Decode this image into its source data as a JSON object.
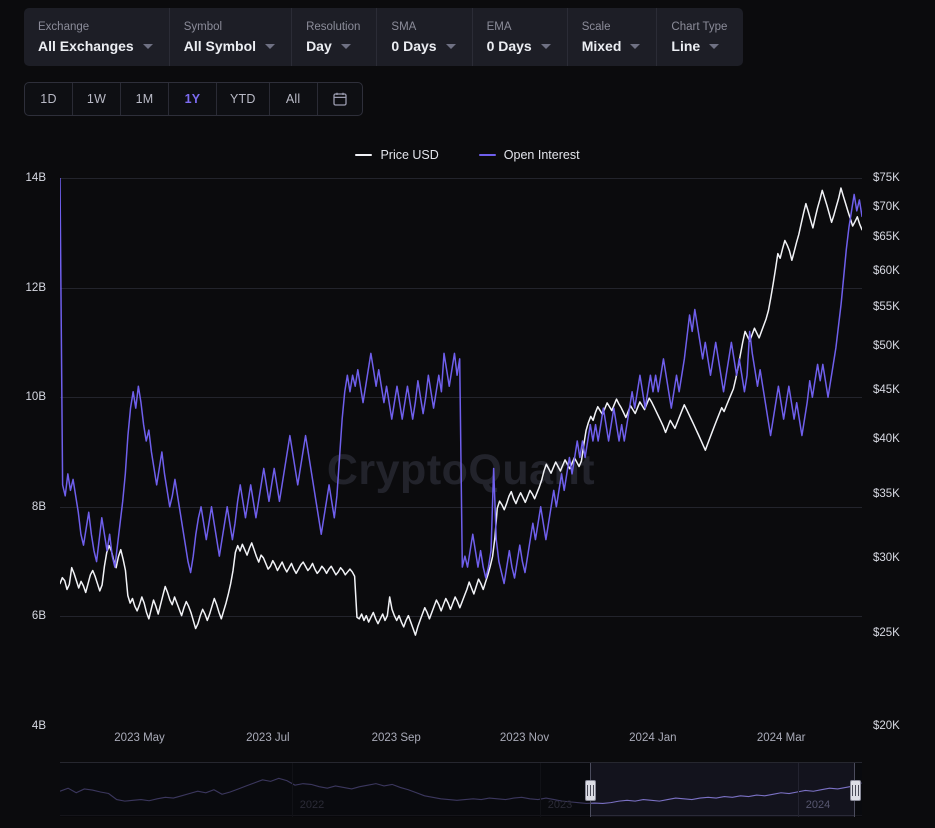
{
  "toolbar": {
    "fields": [
      {
        "label": "Exchange",
        "value": "All Exchanges"
      },
      {
        "label": "Symbol",
        "value": "All Symbol"
      },
      {
        "label": "Resolution",
        "value": "Day"
      },
      {
        "label": "SMA",
        "value": "0 Days"
      },
      {
        "label": "EMA",
        "value": "0 Days"
      },
      {
        "label": "Scale",
        "value": "Mixed"
      },
      {
        "label": "Chart Type",
        "value": "Line"
      }
    ]
  },
  "range_selector": {
    "options": [
      "1D",
      "1W",
      "1M",
      "1Y",
      "YTD",
      "All"
    ],
    "active": "1Y",
    "calendar_icon": "calendar-icon"
  },
  "watermark": "CryptoQuant",
  "colors": {
    "price": "#f2f3f7",
    "open_interest": "#6f5fec",
    "accent": "#7c6bf0",
    "background": "#0b0b0d",
    "grid": "#23242c"
  },
  "navigator": {
    "years": [
      "2022",
      "2023",
      "2024"
    ],
    "handle_left_label": "range-start-handle",
    "handle_right_label": "range-end-handle"
  },
  "chart_data": {
    "type": "line",
    "title": "",
    "xlabel": "",
    "grid": true,
    "legend_position": "top-center",
    "x_tick_labels": [
      "2023 May",
      "2023 Jul",
      "2023 Sep",
      "2023 Nov",
      "2024 Jan",
      "2024 Mar"
    ],
    "x_range": [
      "2023-03-20",
      "2024-03-20"
    ],
    "axes": [
      {
        "id": "left",
        "name": "Open Interest",
        "side": "left",
        "unit": "USD",
        "ylim": [
          4000000000,
          14000000000
        ],
        "tick_labels": [
          "4B",
          "6B",
          "8B",
          "10B",
          "12B",
          "14B"
        ],
        "tick_values": [
          4000000000,
          6000000000,
          8000000000,
          10000000000,
          12000000000,
          14000000000
        ],
        "scale": "linear"
      },
      {
        "id": "right",
        "name": "Price USD",
        "side": "right",
        "unit": "USD",
        "ylim": [
          20000,
          75000
        ],
        "tick_labels": [
          "$20K",
          "$25K",
          "$30K",
          "$35K",
          "$40K",
          "$45K",
          "$50K",
          "$55K",
          "$60K",
          "$65K",
          "$70K",
          "$75K"
        ],
        "tick_values": [
          20000,
          25000,
          30000,
          35000,
          40000,
          45000,
          50000,
          55000,
          60000,
          65000,
          70000,
          75000
        ],
        "scale": "log"
      }
    ],
    "series": [
      {
        "name": "Price USD",
        "color": "#f2f3f7",
        "axis": "right",
        "unit": "USD",
        "values": [
          28200,
          28600,
          28400,
          27800,
          28150,
          29300,
          28900,
          28400,
          27900,
          28350,
          28050,
          27600,
          28200,
          28800,
          29100,
          28700,
          28200,
          27700,
          28100,
          29400,
          30400,
          30900,
          30500,
          29800,
          29300,
          30100,
          30600,
          29900,
          29100,
          27400,
          26900,
          27200,
          26700,
          26400,
          26800,
          27300,
          26900,
          26300,
          25900,
          26500,
          27100,
          26700,
          26200,
          26800,
          27400,
          28000,
          27600,
          27100,
          26800,
          27300,
          26900,
          26500,
          26100,
          26600,
          27000,
          26700,
          26300,
          25800,
          25300,
          25600,
          26100,
          26500,
          26200,
          25800,
          26200,
          26700,
          27200,
          26800,
          26300,
          25900,
          26400,
          26900,
          27500,
          28200,
          29100,
          30400,
          30900,
          30500,
          31000,
          30600,
          30200,
          30700,
          31100,
          30600,
          30100,
          29700,
          30200,
          30000,
          29600,
          29200,
          29400,
          29800,
          29500,
          29100,
          29400,
          29700,
          29300,
          29000,
          29300,
          29600,
          29200,
          28900,
          29200,
          29500,
          29700,
          29400,
          29100,
          29300,
          29600,
          29200,
          28900,
          29100,
          29400,
          29200,
          28900,
          29200,
          29400,
          29100,
          28800,
          29000,
          29300,
          29100,
          28800,
          29000,
          29200,
          29000,
          28700,
          26000,
          25900,
          26200,
          25800,
          26100,
          25700,
          26000,
          26300,
          25900,
          25600,
          25900,
          26200,
          25800,
          26100,
          27300,
          26500,
          26100,
          25800,
          26100,
          25700,
          25400,
          25800,
          26100,
          25700,
          25300,
          24900,
          25400,
          25800,
          26200,
          26600,
          26300,
          25900,
          26300,
          26700,
          27100,
          26800,
          26400,
          26800,
          27200,
          26900,
          26500,
          26900,
          27300,
          27000,
          26600,
          27000,
          27400,
          27800,
          28300,
          27900,
          27500,
          28000,
          28500,
          28200,
          27800,
          28300,
          28800,
          29400,
          30100,
          31500,
          33800,
          34400,
          34100,
          33700,
          34200,
          34800,
          35200,
          34600,
          34200,
          34700,
          35100,
          34700,
          34300,
          34800,
          35300,
          35000,
          34600,
          35100,
          35600,
          36200,
          37000,
          37600,
          37200,
          36800,
          37300,
          37800,
          37400,
          37000,
          37500,
          38000,
          37600,
          37200,
          37700,
          38200,
          37800,
          37400,
          37900,
          39400,
          40800,
          41600,
          42200,
          41800,
          42600,
          43200,
          42800,
          42400,
          43000,
          43600,
          43200,
          42800,
          43400,
          44000,
          43500,
          43100,
          42600,
          42100,
          42700,
          43300,
          42900,
          42500,
          43100,
          43700,
          43300,
          42900,
          43500,
          44100,
          43700,
          43200,
          42700,
          42200,
          41700,
          41200,
          40600,
          41200,
          41800,
          41400,
          41000,
          41600,
          42200,
          42800,
          43400,
          42900,
          42400,
          41900,
          41400,
          40900,
          40400,
          39900,
          39400,
          38900,
          39500,
          40100,
          40700,
          41300,
          41900,
          42500,
          43100,
          42700,
          43300,
          43900,
          44500,
          45100,
          46200,
          47500,
          49000,
          50500,
          51800,
          51200,
          50600,
          51400,
          52200,
          51600,
          51000,
          51800,
          52600,
          53400,
          54500,
          56200,
          58100,
          60200,
          62500,
          61800,
          63200,
          64500,
          63800,
          62900,
          61500,
          62800,
          64200,
          65500,
          67200,
          68900,
          70500,
          69200,
          67800,
          66500,
          68200,
          69800,
          71200,
          72800,
          71500,
          70200,
          68800,
          67400,
          68600,
          70000,
          71400,
          73200,
          71800,
          70500,
          69200,
          68000,
          66800,
          67500,
          68300,
          67100,
          66200
        ]
      },
      {
        "name": "Open Interest",
        "color": "#6f5fec",
        "axis": "left",
        "unit": "USD",
        "values": [
          14000000000,
          8400000000,
          8200000000,
          8600000000,
          8300000000,
          8500000000,
          8200000000,
          7900000000,
          7500000000,
          7300000000,
          7600000000,
          7900000000,
          7500000000,
          7200000000,
          7000000000,
          7400000000,
          7800000000,
          7500000000,
          7200000000,
          7500000000,
          7100000000,
          6900000000,
          7300000000,
          7700000000,
          8100000000,
          8600000000,
          9300000000,
          9800000000,
          10100000000,
          9800000000,
          10200000000,
          9900000000,
          9500000000,
          9200000000,
          9400000000,
          9000000000,
          8700000000,
          8400000000,
          8700000000,
          9000000000,
          8600000000,
          8300000000,
          8000000000,
          8200000000,
          8500000000,
          8200000000,
          7900000000,
          7600000000,
          7300000000,
          7000000000,
          6800000000,
          7100000000,
          7500000000,
          7800000000,
          8000000000,
          7700000000,
          7400000000,
          7700000000,
          8000000000,
          7700000000,
          7400000000,
          7100000000,
          7400000000,
          7700000000,
          8000000000,
          7700000000,
          7400000000,
          7700000000,
          8100000000,
          8400000000,
          8100000000,
          7800000000,
          8100000000,
          8400000000,
          8100000000,
          7800000000,
          8100000000,
          8400000000,
          8700000000,
          8400000000,
          8100000000,
          8400000000,
          8700000000,
          8400000000,
          8100000000,
          8400000000,
          8700000000,
          9000000000,
          9300000000,
          9000000000,
          8700000000,
          8400000000,
          8700000000,
          9000000000,
          9300000000,
          9000000000,
          8700000000,
          8400000000,
          8100000000,
          7800000000,
          7500000000,
          7800000000,
          8100000000,
          8400000000,
          8100000000,
          7800000000,
          8200000000,
          8900000000,
          9600000000,
          10100000000,
          10400000000,
          10100000000,
          10400000000,
          10200000000,
          10500000000,
          10200000000,
          9900000000,
          10200000000,
          10500000000,
          10800000000,
          10500000000,
          10200000000,
          10500000000,
          10200000000,
          9900000000,
          10200000000,
          9900000000,
          9600000000,
          9900000000,
          10200000000,
          9900000000,
          9600000000,
          9900000000,
          10200000000,
          9900000000,
          9600000000,
          9900000000,
          10300000000,
          10000000000,
          9700000000,
          10000000000,
          10400000000,
          10100000000,
          9800000000,
          10100000000,
          10400000000,
          10100000000,
          10800000000,
          10500000000,
          10200000000,
          10500000000,
          10800000000,
          10400000000,
          10700000000,
          6900000000,
          7100000000,
          6900000000,
          7200000000,
          7500000000,
          7200000000,
          6900000000,
          7200000000,
          6900000000,
          6700000000,
          6900000000,
          7200000000,
          8700000000,
          7400000000,
          7000000000,
          6800000000,
          6600000000,
          6900000000,
          7200000000,
          6900000000,
          6700000000,
          7000000000,
          7300000000,
          7000000000,
          6800000000,
          7100000000,
          7400000000,
          7700000000,
          7400000000,
          7700000000,
          8000000000,
          7700000000,
          7400000000,
          7700000000,
          8000000000,
          8300000000,
          8000000000,
          8300000000,
          8600000000,
          8300000000,
          8600000000,
          8900000000,
          8600000000,
          8900000000,
          9200000000,
          8900000000,
          9200000000,
          8900000000,
          9200000000,
          9500000000,
          9200000000,
          9500000000,
          9200000000,
          9500000000,
          9800000000,
          9500000000,
          9200000000,
          9500000000,
          9800000000,
          9500000000,
          9200000000,
          9500000000,
          9200000000,
          9500000000,
          9800000000,
          10100000000,
          9800000000,
          10100000000,
          10400000000,
          10100000000,
          9800000000,
          10100000000,
          10400000000,
          10100000000,
          10400000000,
          10100000000,
          10400000000,
          10700000000,
          10400000000,
          10100000000,
          9800000000,
          10100000000,
          10400000000,
          10100000000,
          10400000000,
          10700000000,
          11100000000,
          11500000000,
          11200000000,
          11600000000,
          11300000000,
          11000000000,
          10700000000,
          11000000000,
          10700000000,
          10400000000,
          10700000000,
          11000000000,
          10700000000,
          10400000000,
          10100000000,
          10400000000,
          10700000000,
          11000000000,
          10700000000,
          10400000000,
          10700000000,
          10400000000,
          10100000000,
          10400000000,
          11200000000,
          10800000000,
          10500000000,
          10200000000,
          10500000000,
          10200000000,
          9900000000,
          9600000000,
          9300000000,
          9600000000,
          9900000000,
          10200000000,
          9900000000,
          9600000000,
          9900000000,
          10200000000,
          9900000000,
          9600000000,
          9900000000,
          9600000000,
          9300000000,
          9600000000,
          9900000000,
          10300000000,
          10000000000,
          10300000000,
          10600000000,
          10300000000,
          10600000000,
          10300000000,
          10000000000,
          10300000000,
          10600000000,
          10900000000,
          11300000000,
          11700000000,
          12200000000,
          12700000000,
          13100000000,
          13400000000,
          13700000000,
          13400000000,
          13600000000,
          13300000000
        ]
      }
    ]
  }
}
